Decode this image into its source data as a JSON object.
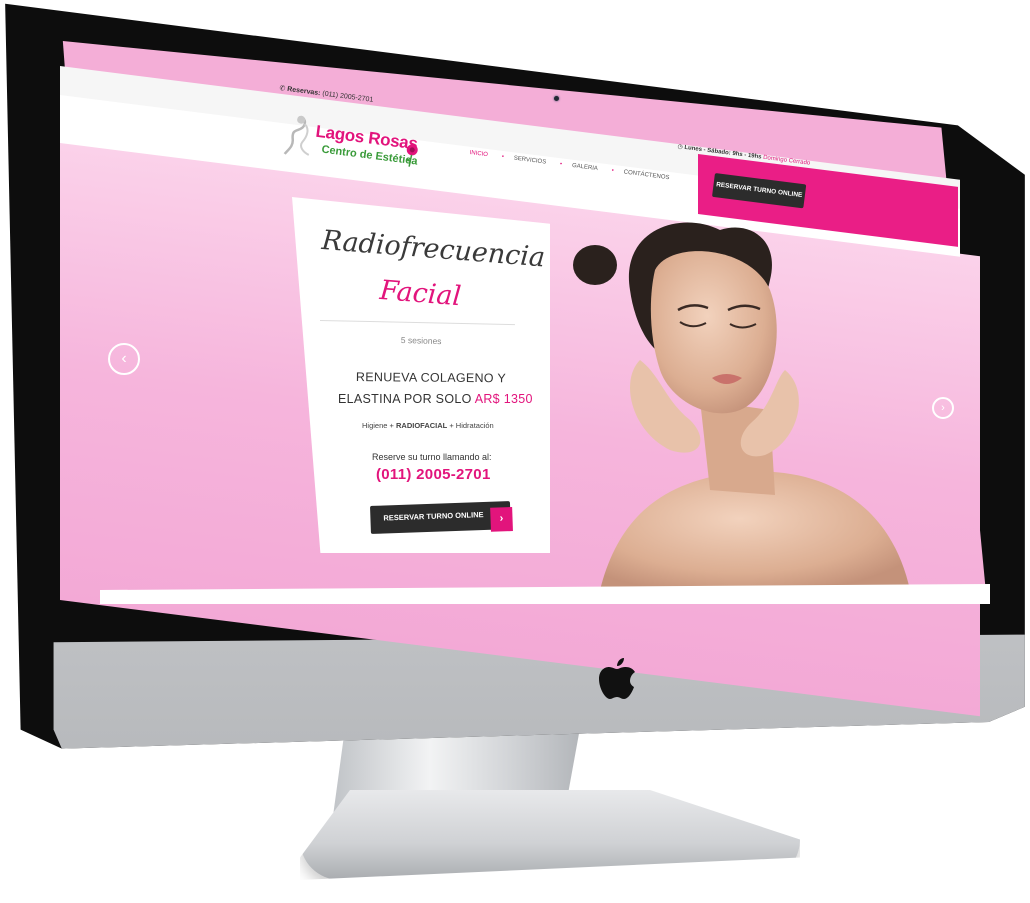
{
  "topbar": {
    "reservas_label": "Reservas:",
    "reservas_phone": "(011) 2005-2701"
  },
  "brand": {
    "name": "Lagos Rosas",
    "tagline": "Centro de Estética"
  },
  "nav": {
    "items": [
      "INICIO",
      "SERVICIOS",
      "GALERIA",
      "CONTÁCTENOS"
    ]
  },
  "hours": {
    "text": "Lunes - Sábado: 9hs - 19hs",
    "closed": "Domingo Cerrado"
  },
  "header_button": {
    "label": "RESERVAR TURNO ONLINE"
  },
  "slide": {
    "title_line1": "Radiofrecuencia",
    "title_line2": "Facial",
    "sessions": "5 sesiones",
    "headline_line1": "RENUEVA COLAGENO Y",
    "headline_line2": "ELASTINA POR SOLO",
    "price": "AR$ 1350",
    "desc_a": "Higiene + ",
    "desc_b": "RADIOFACIAL",
    "desc_c": " + Hidratación",
    "call_text": "Reserve su turno llamando al:",
    "phone": "(011) 2005-2701",
    "cta_label": "RESERVAR TURNO ONLINE"
  },
  "colors": {
    "accent": "#e2147c",
    "hero_pink": "#f6b5dc",
    "dark_button": "#2c2c2c",
    "logo_green": "#3a9b3a"
  },
  "icons": {
    "prev": "chevron-left-icon",
    "next": "chevron-right-icon",
    "phone": "phone-icon",
    "clock": "clock-icon",
    "apple": "apple-logo"
  }
}
